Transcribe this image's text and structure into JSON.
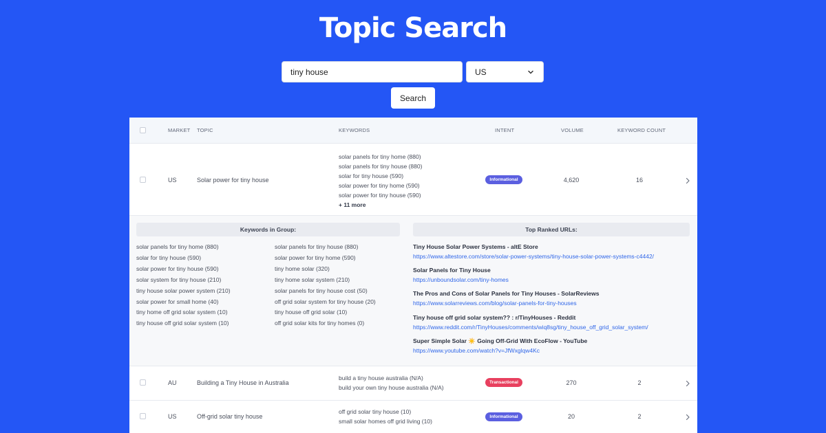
{
  "page": {
    "title": "Topic Search"
  },
  "search": {
    "query": "tiny house",
    "country": "US",
    "button_label": "Search"
  },
  "table": {
    "headers": {
      "market": "MARKET",
      "topic": "TOPIC",
      "keywords": "KEYWORDS",
      "intent": "INTENT",
      "volume": "VOLUME",
      "keyword_count": "KEYWORD COUNT"
    },
    "rows": [
      {
        "market": "US",
        "topic": "Solar power for tiny house",
        "keywords": [
          "solar panels for tiny home (880)",
          "solar panels for tiny house (880)",
          "solar for tiny house (590)",
          "solar power for tiny home (590)",
          "solar power for tiny house (590)"
        ],
        "more": "+ 11 more",
        "intent": "Informational",
        "volume": "4,620",
        "keyword_count": "16"
      },
      {
        "market": "AU",
        "topic": "Building a Tiny House in Australia",
        "keywords": [
          "build a tiny house australia (N/A)",
          "build your own tiny house australia (N/A)"
        ],
        "intent": "Transactional",
        "volume": "270",
        "keyword_count": "2"
      },
      {
        "market": "US",
        "topic": "Off-grid solar tiny house",
        "keywords": [
          "off grid solar tiny house (10)",
          "small solar homes off grid living (10)"
        ],
        "intent": "Informational",
        "volume": "20",
        "keyword_count": "2"
      }
    ]
  },
  "expanded": {
    "keywords_heading": "Keywords in Group:",
    "urls_heading": "Top Ranked URLs:",
    "keywords_col1": [
      "solar panels for tiny home (880)",
      "solar for tiny house (590)",
      "solar power for tiny house (590)",
      "solar system for tiny house (210)",
      "tiny house solar power system (210)",
      "solar power for small home (40)",
      "tiny home off grid solar system (10)",
      "tiny house off grid solar system (10)"
    ],
    "keywords_col2": [
      "solar panels for tiny house (880)",
      "solar power for tiny home (590)",
      "tiny home solar (320)",
      "tiny home solar system (210)",
      "solar panels for tiny house cost (50)",
      "off grid solar system for tiny house (20)",
      "tiny house off grid solar (10)",
      "off grid solar kits for tiny homes (0)"
    ],
    "urls": [
      {
        "title": "Tiny House Solar Power Systems - altE Store",
        "url": "https://www.altestore.com/store/solar-power-systems/tiny-house-solar-power-systems-c4442/"
      },
      {
        "title": "Solar Panels for Tiny House",
        "url": "https://unboundsolar.com/tiny-homes"
      },
      {
        "title": "The Pros and Cons of Solar Panels for Tiny Houses - SolarReviews",
        "url": "https://www.solarreviews.com/blog/solar-panels-for-tiny-houses"
      },
      {
        "title": "Tiny house off grid solar system?? : r/TinyHouses - Reddit",
        "url": "https://www.reddit.com/r/TinyHouses/comments/wiq8sg/tiny_house_off_grid_solar_system/"
      },
      {
        "title": "Super Simple Solar ☀️ Going Off-Grid With EcoFlow - YouTube",
        "url": "https://www.youtube.com/watch?v=JfWxglqw4Kc"
      }
    ]
  },
  "colors": {
    "background": "#2456f5",
    "informational": "#5b5fe0",
    "transactional": "#e8405f",
    "link": "#2f66e8"
  },
  "icons": {
    "select": "chevron-down-icon",
    "row_expand": "chevron-right-icon"
  }
}
